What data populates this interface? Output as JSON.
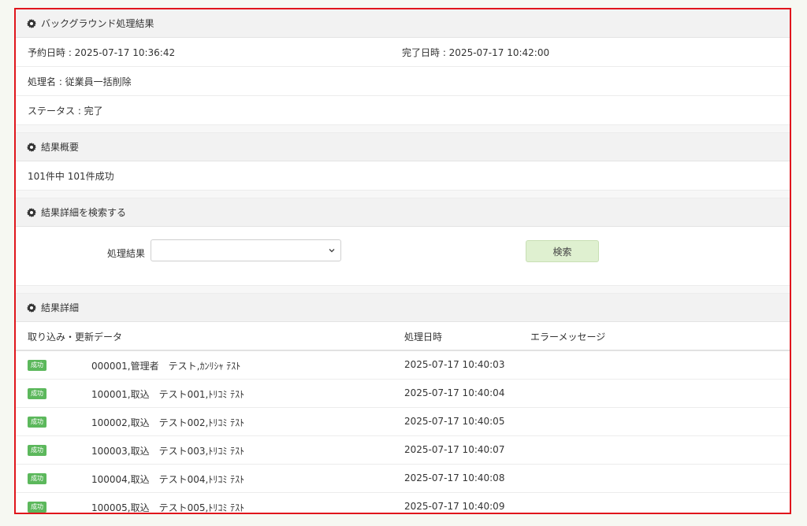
{
  "bg_section": {
    "title": "バックグラウンド処理結果",
    "reserved": "予約日時 : 2025-07-17 10:36:42",
    "completed": "完了日時 : 2025-07-17 10:42:00",
    "process_name": "処理名 : 従業員一括削除",
    "status": "ステータス : 完了"
  },
  "summary_section": {
    "title": "結果概要",
    "text": "101件中 101件成功"
  },
  "search_section": {
    "title": "結果詳細を検索する",
    "label": "処理結果",
    "select_value": "",
    "button": "検索"
  },
  "detail_section": {
    "title": "結果詳細",
    "columns": [
      "取り込み・更新データ",
      "処理日時",
      "エラーメッセージ"
    ],
    "rows": [
      {
        "badge": "成功",
        "data": "000001,管理者　テスト,ｶﾝﾘｼｬ ﾃｽﾄ",
        "date": "2025-07-17 10:40:03"
      },
      {
        "badge": "成功",
        "data": "100001,取込　テスト001,ﾄﾘｺﾐ ﾃｽﾄ",
        "date": "2025-07-17 10:40:04"
      },
      {
        "badge": "成功",
        "data": "100002,取込　テスト002,ﾄﾘｺﾐ ﾃｽﾄ",
        "date": "2025-07-17 10:40:05"
      },
      {
        "badge": "成功",
        "data": "100003,取込　テスト003,ﾄﾘｺﾐ ﾃｽﾄ",
        "date": "2025-07-17 10:40:07"
      },
      {
        "badge": "成功",
        "data": "100004,取込　テスト004,ﾄﾘｺﾐ ﾃｽﾄ",
        "date": "2025-07-17 10:40:08"
      },
      {
        "badge": "成功",
        "data": "100005,取込　テスト005,ﾄﾘｺﾐ ﾃｽﾄ",
        "date": "2025-07-17 10:40:09"
      }
    ]
  },
  "colors": {
    "highlight_border": "#e0161c",
    "success_badge": "#5cb85c",
    "search_button": "#dff0d0"
  },
  "icons": {
    "section_icon": "gear-icon",
    "select_icon": "chevron-down-icon"
  }
}
